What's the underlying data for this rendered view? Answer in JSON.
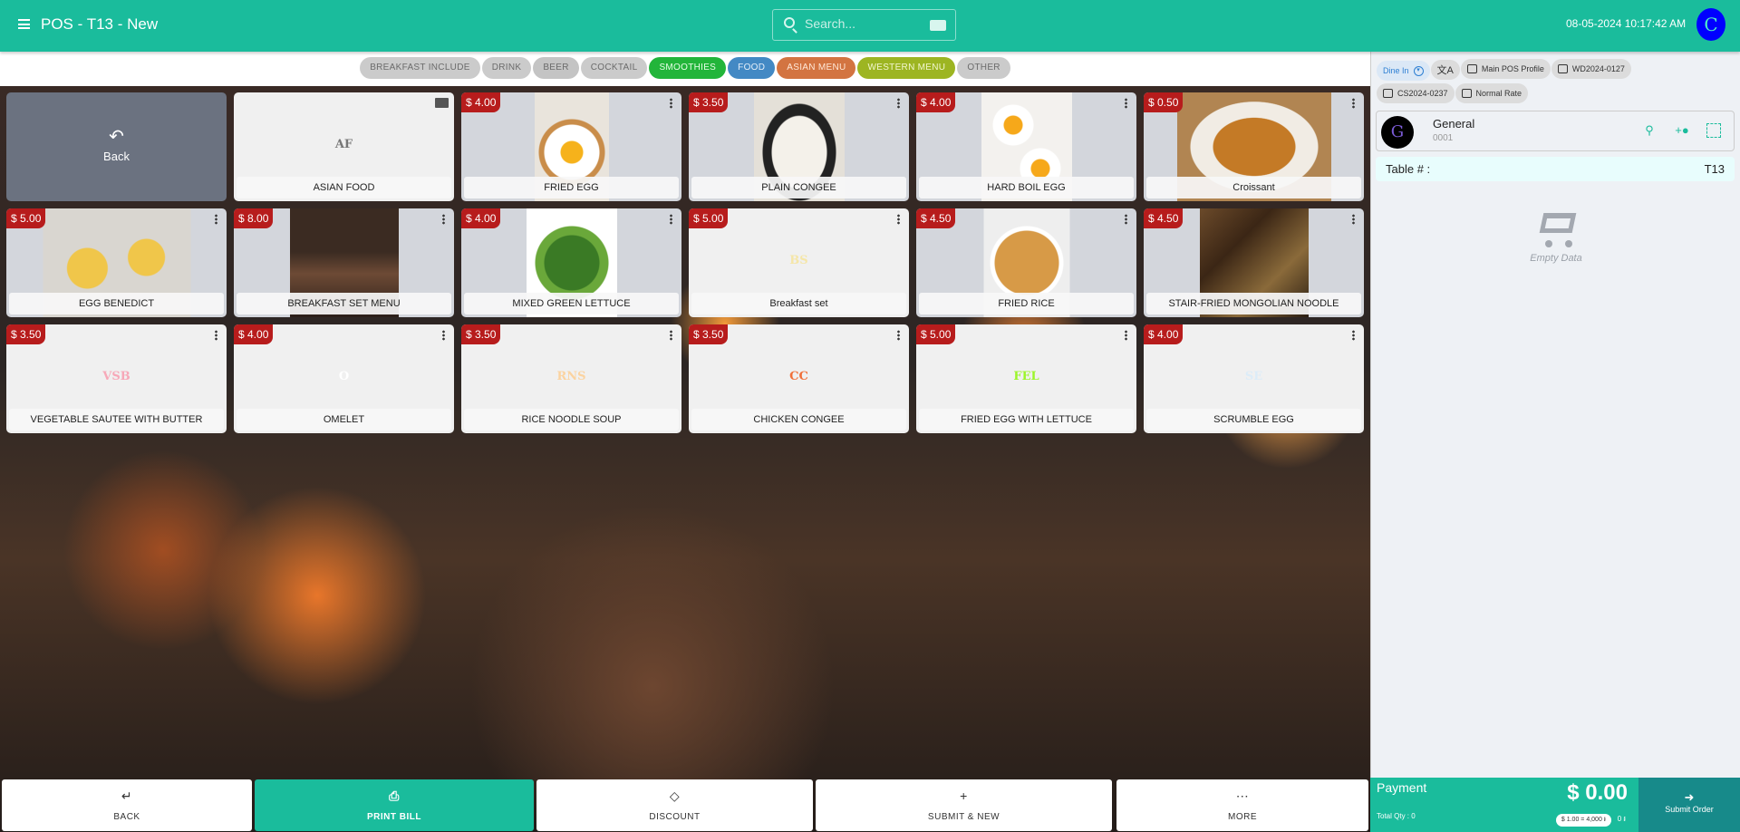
{
  "header": {
    "title": "POS - T13 - New",
    "search_placeholder": "Search...",
    "datetime": "08-05-2024 10:17:42 AM",
    "user_initial": "C"
  },
  "categories": [
    {
      "label": "BREAKFAST INCLUDE",
      "bg": "#cbcbcb",
      "fg": "#6b6b6b"
    },
    {
      "label": "DRINK",
      "bg": "#cbcbcb",
      "fg": "#6b6b6b"
    },
    {
      "label": "BEER",
      "bg": "#c4c4c4",
      "fg": "#6b6b6b"
    },
    {
      "label": "COCKTAIL",
      "bg": "#cbcbcb",
      "fg": "#6b6b6b"
    },
    {
      "label": "SMOOTHIES",
      "bg": "#22b53a",
      "fg": "#e8ffe8"
    },
    {
      "label": "FOOD",
      "bg": "#4389c4",
      "fg": "#e6f0fa"
    },
    {
      "label": "ASIAN MENU",
      "bg": "#d37441",
      "fg": "#ffe8d8"
    },
    {
      "label": "WESTERN MENU",
      "bg": "#9db522",
      "fg": "#f2f7d0"
    },
    {
      "label": "OTHER",
      "bg": "#cbcbcb",
      "fg": "#6b6b6b"
    }
  ],
  "grid": {
    "back_label": "Back",
    "items": [
      {
        "name": "ASIAN FOOD",
        "initials": "AF",
        "initials_color": "#777777",
        "folder": true
      },
      {
        "name": "FRIED EGG",
        "price": "$ 4.00",
        "image": "fried-egg"
      },
      {
        "name": "PLAIN CONGEE",
        "price": "$ 3.50",
        "image": "plain-congee"
      },
      {
        "name": "HARD BOIL EGG",
        "price": "$ 4.00",
        "image": "hard-boil-egg"
      },
      {
        "name": "Croissant",
        "price": "$ 0.50",
        "image": "croissant"
      },
      {
        "name": "EGG BENEDICT",
        "price": "$ 5.00",
        "image": "egg-benedict"
      },
      {
        "name": "BREAKFAST SET MENU",
        "price": "$ 8.00",
        "image": "american-breakfast"
      },
      {
        "name": "MIXED GREEN LETTUCE",
        "price": "$ 4.00",
        "image": "lettuce"
      },
      {
        "name": "Breakfast set",
        "price": "$ 5.00",
        "initials": "BS",
        "initials_color": "#f5e6a8"
      },
      {
        "name": "FRIED RICE",
        "price": "$ 4.50",
        "image": "fried-rice"
      },
      {
        "name": "STAIR-FRIED MONGOLIAN NOODLE",
        "price": "$ 4.50",
        "image": "noodle"
      },
      {
        "name": "VEGETABLE SAUTEE WITH BUTTER",
        "price": "$ 3.50",
        "initials": "VSB",
        "initials_color": "#f7a8b8"
      },
      {
        "name": "OMELET",
        "price": "$ 4.00",
        "initials": "O",
        "initials_color": "#ffffff"
      },
      {
        "name": "RICE NOODLE SOUP",
        "price": "$ 3.50",
        "initials": "RNS",
        "initials_color": "#fbd3a0"
      },
      {
        "name": "CHICKEN CONGEE",
        "price": "$ 3.50",
        "initials": "CC",
        "initials_color": "#f0703a"
      },
      {
        "name": "FRIED EGG WITH LETTUCE",
        "price": "$ 5.00",
        "initials": "FEL",
        "initials_color": "#9cf52a"
      },
      {
        "name": "SCRUMBLE EGG",
        "price": "$ 4.00",
        "initials": "SE",
        "initials_color": "#dcecf8"
      }
    ]
  },
  "bottom": {
    "back": "BACK",
    "print": "PRINT BILL",
    "discount": "DISCOUNT",
    "submit_new": "SUBMIT & NEW",
    "more": "MORE"
  },
  "panel": {
    "chips": [
      "Dine In",
      "",
      "Main POS Profile",
      "WD2024-0127",
      "CS2024-0237",
      "Normal Rate"
    ],
    "customer": {
      "initial": "G",
      "name": "General",
      "code": "0001"
    },
    "table_label": "Table # :",
    "table_value": "T13",
    "empty": "Empty Data"
  },
  "payment": {
    "label": "Payment",
    "amount": "$ 0.00",
    "total_qty": "Total Qty : 0",
    "rate": "$ 1.00 = 4,000 ៛",
    "riel": "0 ៛",
    "submit": "Submit Order"
  },
  "colors": {
    "accent": "#1abc9c",
    "price_badge": "#b71c1c",
    "submit": "#178a8a"
  }
}
